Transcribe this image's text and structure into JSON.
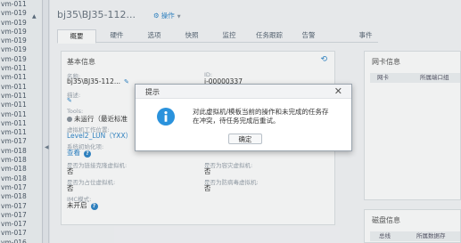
{
  "sidebar": {
    "items": [
      "vm-011",
      "vm-019",
      "vm-019",
      "vm-019",
      "vm-019",
      "vm-019",
      "vm-019",
      "vm-011",
      "vm-011",
      "vm-011",
      "vm-011",
      "vm-011",
      "vm-011",
      "vm-011",
      "vm-011",
      "vm-017",
      "vm-018",
      "vm-018",
      "vm-018",
      "vm-018",
      "vm-017",
      "vm-018",
      "vm-017",
      "vm-017",
      "vm-017",
      "vm-017",
      "vm-016"
    ],
    "collapse_arrow": "▲",
    "splitter_arrow": "◀"
  },
  "header": {
    "title": "bj35\\BJ35-112...",
    "operate_label": "操作"
  },
  "tabs": [
    "概要",
    "硬件",
    "选项",
    "快照",
    "监控",
    "任务跟踪",
    "告警",
    "事件"
  ],
  "basic_info": {
    "title": "基本信息",
    "name_label": "名称:",
    "name_value": "bj35\\BJ35-112...",
    "id_label": "ID:",
    "id_value": "i-00000337",
    "desc_label": "描述:",
    "tools_label": "Tools:",
    "tools_value": "未运行（最近标准",
    "location_label": "虚拟机工作位置:",
    "location_value": "Level2_LUN（YXX）",
    "init_label": "系统初始化项:",
    "init_value": "查看",
    "f1_label": "是否为链接克隆虚拟机:",
    "f1_value": "否",
    "f2_label": "是否为容灾虚拟机:",
    "f2_value": "否",
    "f3_label": "是否为占位虚拟机:",
    "f3_value": "否",
    "f4_label": "是否为防病毒虚拟机:",
    "f4_value": "否",
    "imc_label": "IMC模式:",
    "imc_value": "未开启"
  },
  "nic_panel": {
    "title": "网卡信息",
    "col1": "网卡",
    "col2": "所属端口组"
  },
  "disk_panel": {
    "title": "磁盘信息",
    "col1": "总线",
    "col2": "所属数据存"
  },
  "dialog": {
    "title": "提示",
    "close": "✕",
    "message": "对此虚拟机/模板当前的操作和未完成的任务存在冲突，待任务完成后重试。",
    "ok_label": "确定"
  },
  "colors": {
    "accent": "#2f86c9",
    "info_icon": "#2a92dc"
  }
}
